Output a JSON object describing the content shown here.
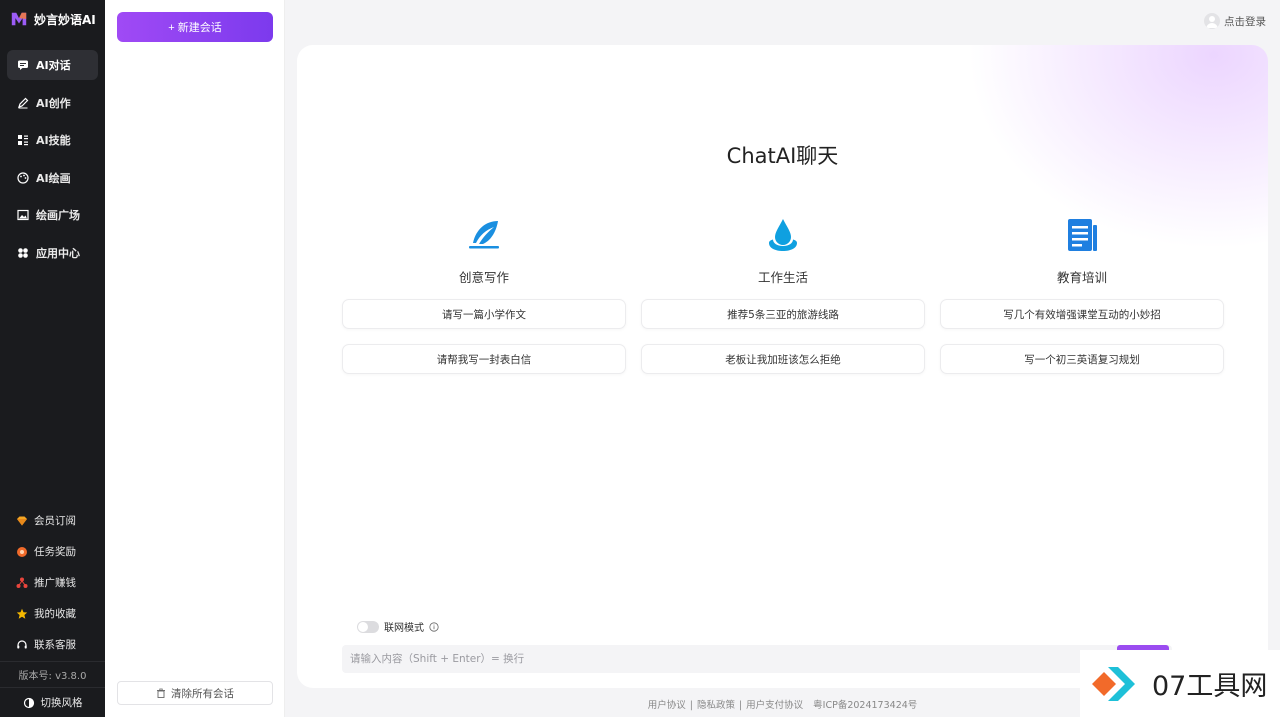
{
  "brand": {
    "name": "妙言妙语AI"
  },
  "nav": [
    {
      "label": "AI对话",
      "icon": "chat-icon",
      "active": true
    },
    {
      "label": "AI创作",
      "icon": "pen-icon",
      "active": false
    },
    {
      "label": "AI技能",
      "icon": "grid-icon",
      "active": false
    },
    {
      "label": "AI绘画",
      "icon": "palette-icon",
      "active": false
    },
    {
      "label": "绘画广场",
      "icon": "image-icon",
      "active": false
    },
    {
      "label": "应用中心",
      "icon": "apps-icon",
      "active": false
    }
  ],
  "bottom_menu": [
    {
      "label": "会员订阅",
      "icon": "diamond-icon",
      "color": "#f5a623"
    },
    {
      "label": "任务奖励",
      "icon": "reward-icon",
      "color": "#f06a2a"
    },
    {
      "label": "推广赚钱",
      "icon": "share-icon",
      "color": "#e8453c"
    },
    {
      "label": "我的收藏",
      "icon": "star-icon",
      "color": "#f5b800"
    },
    {
      "label": "联系客服",
      "icon": "headset-icon",
      "color": "#ffffff"
    }
  ],
  "version": "版本号: v3.8.0",
  "switch_style": "切换风格",
  "conversations": {
    "new_chat": "+ 新建会话",
    "clear_all": "清除所有会话"
  },
  "header": {
    "login": "点击登录"
  },
  "main": {
    "title": "ChatAI聊天",
    "columns": [
      {
        "title": "创意写作",
        "icon": "feather-icon",
        "color": "#1a8fe0",
        "suggestions": [
          "请写一篇小学作文",
          "请帮我写一封表白信"
        ]
      },
      {
        "title": "工作生活",
        "icon": "water-drop-icon",
        "color": "#0fa0e0",
        "suggestions": [
          "推荐5条三亚的旅游线路",
          "老板让我加班该怎么拒绝"
        ]
      },
      {
        "title": "教育培训",
        "icon": "document-icon",
        "color": "#1f7fe0",
        "suggestions": [
          "写几个有效增强课堂互动的小妙招",
          "写一个初三英语复习规划"
        ]
      }
    ],
    "web_mode": "联网模式",
    "input_placeholder": "请输入内容（Shift + Enter）= 换行"
  },
  "footer": {
    "links": [
      "用户协议",
      "|",
      "隐私政策",
      "|",
      "用户支付协议",
      "粤ICP备2024173424号"
    ]
  },
  "watermark": {
    "text": "07工具网"
  },
  "colors": {
    "accent": "#8b3ef0",
    "sidebar_bg": "#1a1b1e"
  }
}
